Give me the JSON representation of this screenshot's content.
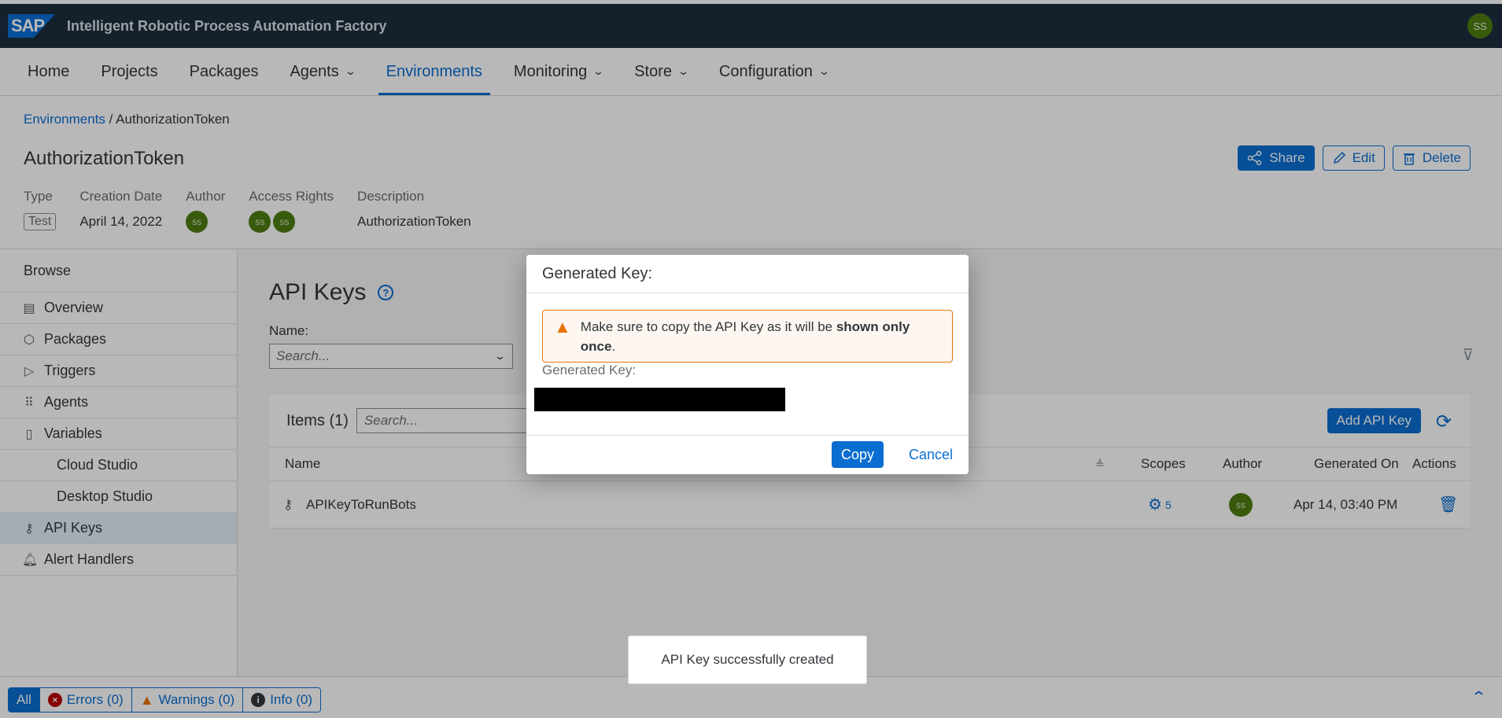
{
  "app": {
    "logo": "SAP",
    "title": "Intelligent Robotic Process Automation Factory",
    "user_initials": "SS"
  },
  "nav": {
    "items": [
      {
        "label": "Home",
        "dropdown": false
      },
      {
        "label": "Projects",
        "dropdown": false
      },
      {
        "label": "Packages",
        "dropdown": false
      },
      {
        "label": "Agents",
        "dropdown": true
      },
      {
        "label": "Environments",
        "dropdown": false,
        "active": true
      },
      {
        "label": "Monitoring",
        "dropdown": true
      },
      {
        "label": "Store",
        "dropdown": true
      },
      {
        "label": "Configuration",
        "dropdown": true
      }
    ]
  },
  "header": {
    "breadcrumb": {
      "link": "Environments",
      "separator": " / ",
      "current": "AuthorizationToken"
    },
    "title": "AuthorizationToken",
    "actions": {
      "share": "Share",
      "edit": "Edit",
      "delete": "Delete"
    },
    "meta": {
      "type_label": "Type",
      "type_value": "Test",
      "date_label": "Creation Date",
      "date_value": "April 14, 2022",
      "author_label": "Author",
      "author_initials": "ss",
      "access_label": "Access Rights",
      "access_initials_1": "ss",
      "access_initials_2": "ss",
      "desc_label": "Description",
      "desc_value": "AuthorizationToken"
    }
  },
  "sidebar": {
    "head": "Browse",
    "items": [
      {
        "label": "Overview",
        "icon": "overview-icon"
      },
      {
        "label": "Packages",
        "icon": "package-icon"
      },
      {
        "label": "Triggers",
        "icon": "play-icon"
      },
      {
        "label": "Agents",
        "icon": "agents-icon"
      },
      {
        "label": "Variables",
        "icon": "variables-icon"
      },
      {
        "label": "Cloud Studio",
        "sub": true
      },
      {
        "label": "Desktop Studio",
        "sub": true
      },
      {
        "label": "API Keys",
        "icon": "key-icon",
        "active": true
      },
      {
        "label": "Alert Handlers",
        "icon": "bell-icon"
      }
    ]
  },
  "main": {
    "section_title": "API Keys",
    "filter": {
      "label": "Name:",
      "placeholder": "Search..."
    },
    "table": {
      "count": "Items (1)",
      "search_placeholder": "Search...",
      "add_button": "Add API Key",
      "columns": {
        "name": "Name",
        "scopes": "Scopes",
        "author": "Author",
        "generated": "Generated On",
        "actions": "Actions"
      },
      "rows": [
        {
          "name": "APIKeyToRunBots",
          "scopes": "5",
          "author": "ss",
          "generated": "Apr 14, 03:40 PM"
        }
      ]
    }
  },
  "statusbar": {
    "all": "All",
    "errors": "Errors (0)",
    "warnings": "Warnings (0)",
    "info": "Info (0)"
  },
  "dialog": {
    "title": "Generated Key:",
    "warning_pre": "Make sure to copy the API Key as it will be ",
    "warning_bold": "shown only once",
    "warning_post": ".",
    "key_label": "Generated Key:",
    "copy": "Copy",
    "cancel": "Cancel"
  },
  "toast": "API Key successfully created",
  "colors": {
    "shell": "#1d2d3e",
    "accent": "#0a6ed1",
    "warning": "#e9730c",
    "error": "#bb0000",
    "avatar": "#4e7d12"
  }
}
